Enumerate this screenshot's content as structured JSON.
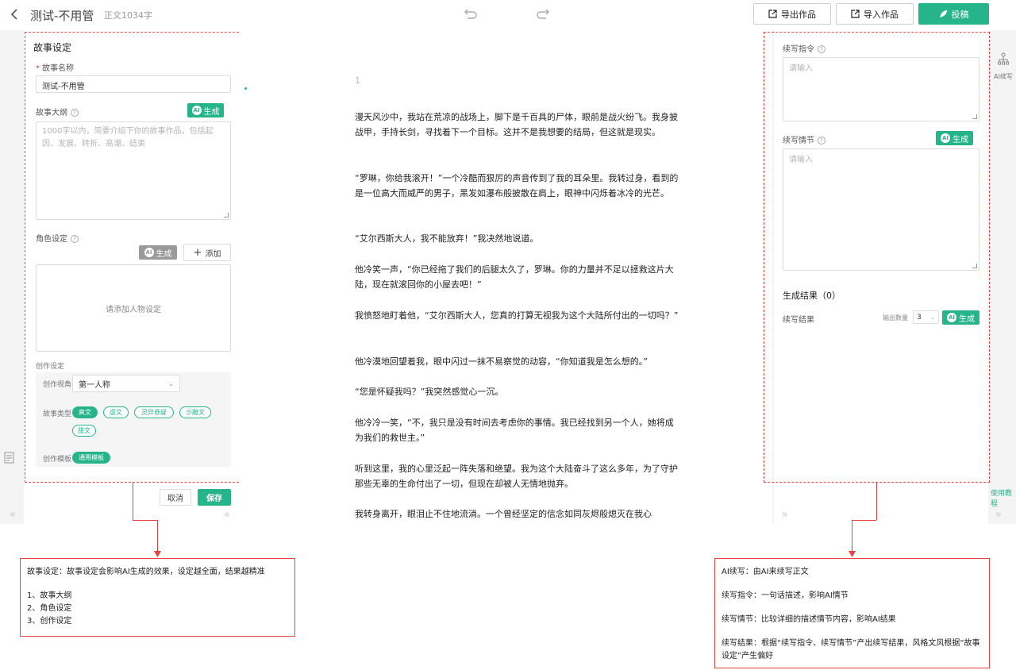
{
  "topbar": {
    "title": "测试-不用管",
    "word_count": "正文1034字",
    "export_label": "导出作品",
    "import_label": "导入作品",
    "submit_label": "投稿"
  },
  "story_settings": {
    "heading": "故事设定",
    "name_label": "故事名称",
    "name_value": "测试-不用管",
    "outline_label": "故事大纲",
    "outline_generate": "生成",
    "outline_placeholder": "1000字以内，简要介绍下你的故事作品，包括起因、发展、转折、高潮、结束",
    "character_label": "角色设定",
    "character_generate": "生成",
    "character_add": "添加",
    "character_empty": "请添加人物设定",
    "creation_label": "创作设定",
    "perspective_label": "创作视角",
    "perspective_value": "第一人称",
    "type_label": "故事类型",
    "types": [
      "爽文",
      "虐文",
      "灵异悬疑",
      "沙雕文",
      "甜文"
    ],
    "template_label": "创作模板",
    "template_value": "通用模板",
    "cancel_label": "取消",
    "save_label": "保存"
  },
  "editor": {
    "line_number": "1",
    "paragraphs": [
      "漫天风沙中，我站在荒凉的战场上，脚下是千百具的尸体，眼前是战火纷飞。我身披战甲，手持长剑，寻找着下一个目标。这并不是我想要的结局，但这就是现实。",
      "“罗琳，你给我滚开！”一个冷酷而狠厉的声音传到了我的耳朵里。我转过身，看到的是一位高大而威严的男子，黑发如瀑布般披散在肩上，眼神中闪烁着冰冷的光芒。",
      "“艾尔西斯大人，我不能放弃！”我决然地说道。",
      "他冷笑一声，“你已经拖了我们的后腿太久了，罗琳。你的力量并不足以拯救这片大陆，现在就滚回你的小屋去吧！”",
      "我愤怒地盯着他，“艾尔西斯大人，您真的打算无视我为这个大陆所付出的一切吗？”",
      "他冷漠地回望着我，眼中闪过一抹不易察觉的动容，“你知道我是怎么想的。”",
      "“您是怀疑我吗？”我突然感觉心一沉。",
      "他冷冷一笑，“不，我只是没有时间去考虑你的事情。我已经找到另一个人，她将成为我们的救世主。”",
      "听到这里，我的心里泛起一阵失落和绝望。我为这个大陆奋斗了这么多年，为了守护那些无辜的生命付出了一切，但现在却被人无情地抛弃。",
      "我转身离开，眼泪止不住地流淌。一个曾经坚定的信念如同灰烬般熄灭在我心"
    ]
  },
  "ai_continue": {
    "instruction_label": "续写指令",
    "instruction_placeholder": "请输入",
    "plot_label": "续写情节",
    "plot_generate": "生成",
    "plot_placeholder": "请输入",
    "results_heading": "生成结果（0）",
    "results_label": "续写结果",
    "count_label": "输出数量",
    "count_value": "3",
    "results_generate": "生成"
  },
  "rail": {
    "ai_label": "AI续写",
    "tutorial": "使用教程"
  },
  "annotations": {
    "left_title": "故事设定：故事设定会影响AI生成的效果，设定越全面，结果越精准",
    "left_items": [
      "1、故事大纲",
      "2、角色设定",
      "3、创作设定"
    ],
    "right_lines": [
      "AI续写：由AI来续写正文",
      "续写指令：一句话描述，影响AI情节",
      "续写情节：比较详细的描述情节内容，影响AI结果",
      "续写结果：根据“续写指令、续写情节”产出续写结果，风格文风根据“故事设定”产生偏好"
    ]
  },
  "colors": {
    "accent": "#26b48a",
    "annotation_red": "#e94040"
  }
}
